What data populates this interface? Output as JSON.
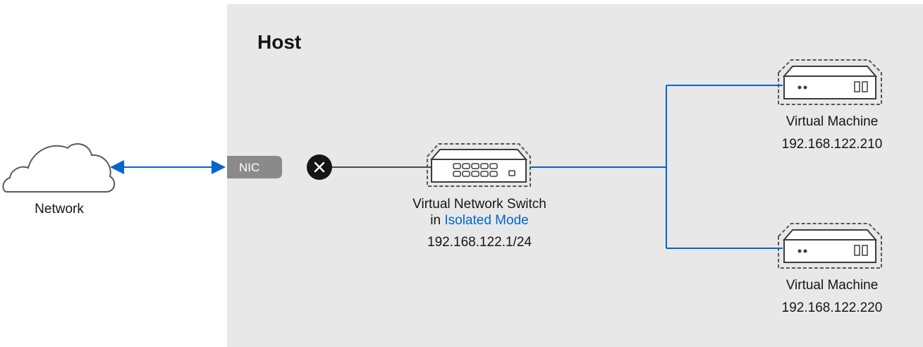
{
  "host": {
    "title": "Host"
  },
  "network": {
    "label": "Network"
  },
  "nic": {
    "label": "NIC"
  },
  "switch": {
    "line1": "Virtual Network Switch",
    "line2_prefix": "in ",
    "line2_mode": "Isolated Mode",
    "ip": "192.168.122.1/24"
  },
  "vms": [
    {
      "label": "Virtual Machine",
      "ip": "192.168.122.210"
    },
    {
      "label": "Virtual Machine",
      "ip": "192.168.122.220"
    }
  ],
  "colors": {
    "host_bg": "#e8e8e8",
    "link": "#0066cc",
    "nic": "#8a8a8a",
    "blocked": "#151515"
  },
  "icons": [
    "cloud-icon",
    "blocked-x-icon",
    "switch-icon",
    "server-icon"
  ]
}
